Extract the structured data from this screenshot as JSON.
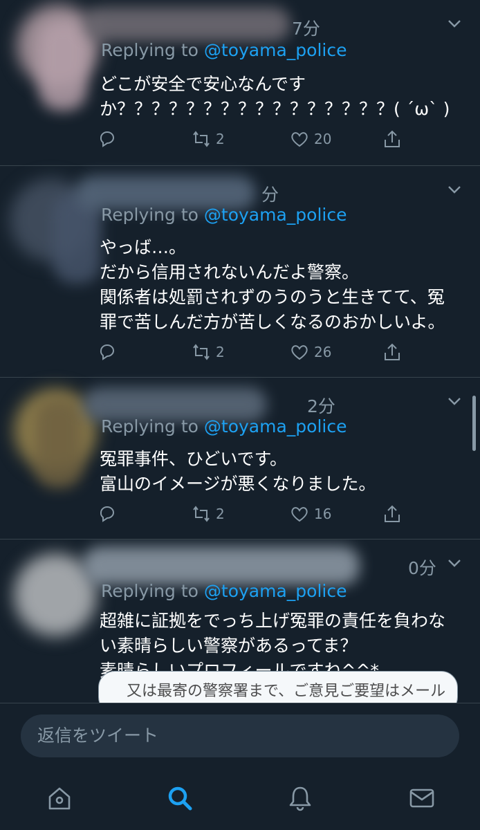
{
  "colors": {
    "background": "#15202b",
    "accent": "#1da1f2",
    "muted": "#8899a6",
    "divider": "#38444d"
  },
  "tweets": [
    {
      "time": "7分",
      "reply_prefix": "Replying to ",
      "reply_handle": "@toyama_police",
      "text": "どこが安全で安心なんです\nか？？？？？？？？？？？？？？？？( ´ω` )",
      "retweets": "2",
      "likes": "20"
    },
    {
      "time": "分",
      "reply_prefix": "Replying to ",
      "reply_handle": "@toyama_police",
      "text": "やっば…。\nだから信用されないんだよ警察。\n関係者は処罰されずのうのうと生きてて、冤\n罪で苦しんだ方が苦しくなるのおかしいよ。",
      "retweets": "2",
      "likes": "26"
    },
    {
      "time": "2分",
      "reply_prefix": "Replying to ",
      "reply_handle": "@toyama_police",
      "text": "冤罪事件、ひどいです。\n富山のイメージが悪くなりました。",
      "retweets": "2",
      "likes": "16"
    },
    {
      "time": "0分",
      "reply_prefix": "Replying to ",
      "reply_handle": "@toyama_police",
      "text": "超雑に証拠をでっち上げ冤罪の責任を負わな\nい素晴らしい警察があるってま？\n素晴らしいプロフィールですね^^*",
      "card_text": "又は最寄の警察署まで、ご意見ご要望はメール"
    }
  ],
  "composer": {
    "placeholder": "返信をツイート"
  },
  "tabbar": {
    "items": [
      "home-icon",
      "search-icon",
      "notifications-icon",
      "messages-icon"
    ],
    "active": "search-icon"
  }
}
